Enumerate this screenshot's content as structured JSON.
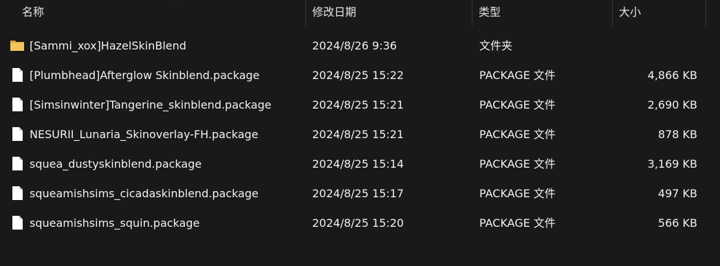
{
  "columns": {
    "name": "名称",
    "date": "修改日期",
    "type": "类型",
    "size": "大小"
  },
  "files": [
    {
      "name": "[Sammi_xox]HazelSkinBlend",
      "date": "2024/8/26 9:36",
      "type": "文件夹",
      "size": "",
      "icon": "folder-icon"
    },
    {
      "name": "[Plumbhead]Afterglow Skinblend.package",
      "date": "2024/8/25 15:22",
      "type": "PACKAGE 文件",
      "size": "4,866 KB",
      "icon": "file-icon"
    },
    {
      "name": "[Simsinwinter]Tangerine_skinblend.package",
      "date": "2024/8/25 15:21",
      "type": "PACKAGE 文件",
      "size": "2,690 KB",
      "icon": "file-icon"
    },
    {
      "name": "NESURII_Lunaria_Skinoverlay-FH.package",
      "date": "2024/8/25 15:21",
      "type": "PACKAGE 文件",
      "size": "878 KB",
      "icon": "file-icon"
    },
    {
      "name": "squea_dustyskinblend.package",
      "date": "2024/8/25 15:14",
      "type": "PACKAGE 文件",
      "size": "3,169 KB",
      "icon": "file-icon"
    },
    {
      "name": "squeamishsims_cicadaskinblend.package",
      "date": "2024/8/25 15:17",
      "type": "PACKAGE 文件",
      "size": "497 KB",
      "icon": "file-icon"
    },
    {
      "name": "squeamishsims_squin.package",
      "date": "2024/8/25 15:20",
      "type": "PACKAGE 文件",
      "size": "566 KB",
      "icon": "file-icon"
    }
  ],
  "colors": {
    "background": "#191919",
    "text": "#f2f2f2",
    "folder": "#e8b84a"
  }
}
